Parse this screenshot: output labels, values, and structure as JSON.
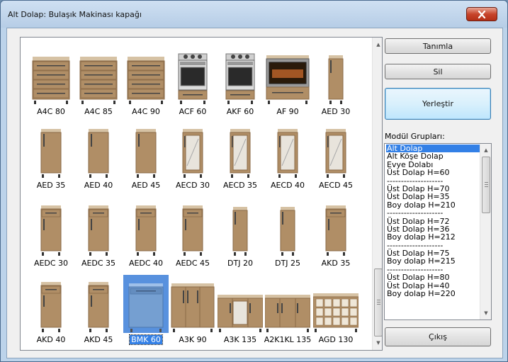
{
  "window": {
    "title": "Alt Dolap:  Bulaşık Makinası kapağı",
    "close_icon": "close-icon"
  },
  "modules": [
    {
      "label": "A4C 80",
      "kind": "drawers4"
    },
    {
      "label": "A4C 85",
      "kind": "drawers4"
    },
    {
      "label": "A4C 90",
      "kind": "drawers4"
    },
    {
      "label": "ACF 60",
      "kind": "cooker"
    },
    {
      "label": "AKF 60",
      "kind": "cooker"
    },
    {
      "label": "AF 90",
      "kind": "oven"
    },
    {
      "label": "AED 30",
      "kind": "door-narrow"
    },
    {
      "label": "AED 35",
      "kind": "door"
    },
    {
      "label": "AED 40",
      "kind": "door"
    },
    {
      "label": "AED 45",
      "kind": "door"
    },
    {
      "label": "AECD 30",
      "kind": "glass"
    },
    {
      "label": "AECD 35",
      "kind": "glass"
    },
    {
      "label": "AECD 40",
      "kind": "glass"
    },
    {
      "label": "AECD 45",
      "kind": "glass"
    },
    {
      "label": "AEDC 30",
      "kind": "door-drawer"
    },
    {
      "label": "AEDC 35",
      "kind": "door-drawer"
    },
    {
      "label": "AEDC 40",
      "kind": "door-drawer"
    },
    {
      "label": "AEDC 45",
      "kind": "door-drawer"
    },
    {
      "label": "DTJ 20",
      "kind": "door-narrow"
    },
    {
      "label": "DTJ 25",
      "kind": "door-narrow"
    },
    {
      "label": "AKD 35",
      "kind": "door-drawer"
    },
    {
      "label": "AKD 40",
      "kind": "door-drawer"
    },
    {
      "label": "AKD 45",
      "kind": "door-drawer"
    },
    {
      "label": "BMK 60",
      "kind": "dishwasher",
      "selected": true
    },
    {
      "label": "A3K 90",
      "kind": "triple"
    },
    {
      "label": "A3K 135",
      "kind": "low-open"
    },
    {
      "label": "A2K1KL 135",
      "kind": "low"
    },
    {
      "label": "AGD 130",
      "kind": "wine"
    }
  ],
  "buttons": {
    "tanimla": "Tanımla",
    "sil": "Sil",
    "yerlestir": "Yerleştir",
    "cikis": "Çıkış"
  },
  "groups": {
    "label": "Modül Grupları:",
    "items": [
      "Alt Dolap",
      "Alt Köşe Dolap",
      "Evye Dolabı",
      "Üst Dolap H=60",
      "--------------------",
      "Üst Dolap H=70",
      "Üst Dolap H=35",
      "Boy dolap H=210",
      "--------------------",
      "Üst Dolap H=72",
      "Üst Dolap H=36",
      "Boy dolap H=212",
      "--------------------",
      "Üst Dolap H=75",
      "Boy dolap H=215",
      "--------------------",
      "Üst Dolap H=80",
      "Üst Dolap H=40",
      "Boy dolap H=220"
    ],
    "selected_index": 0
  },
  "colors": {
    "wood": "#b08e66",
    "wood_dark": "#8a6a47",
    "top": "#d6c2a4",
    "selection": "#3380e6"
  }
}
